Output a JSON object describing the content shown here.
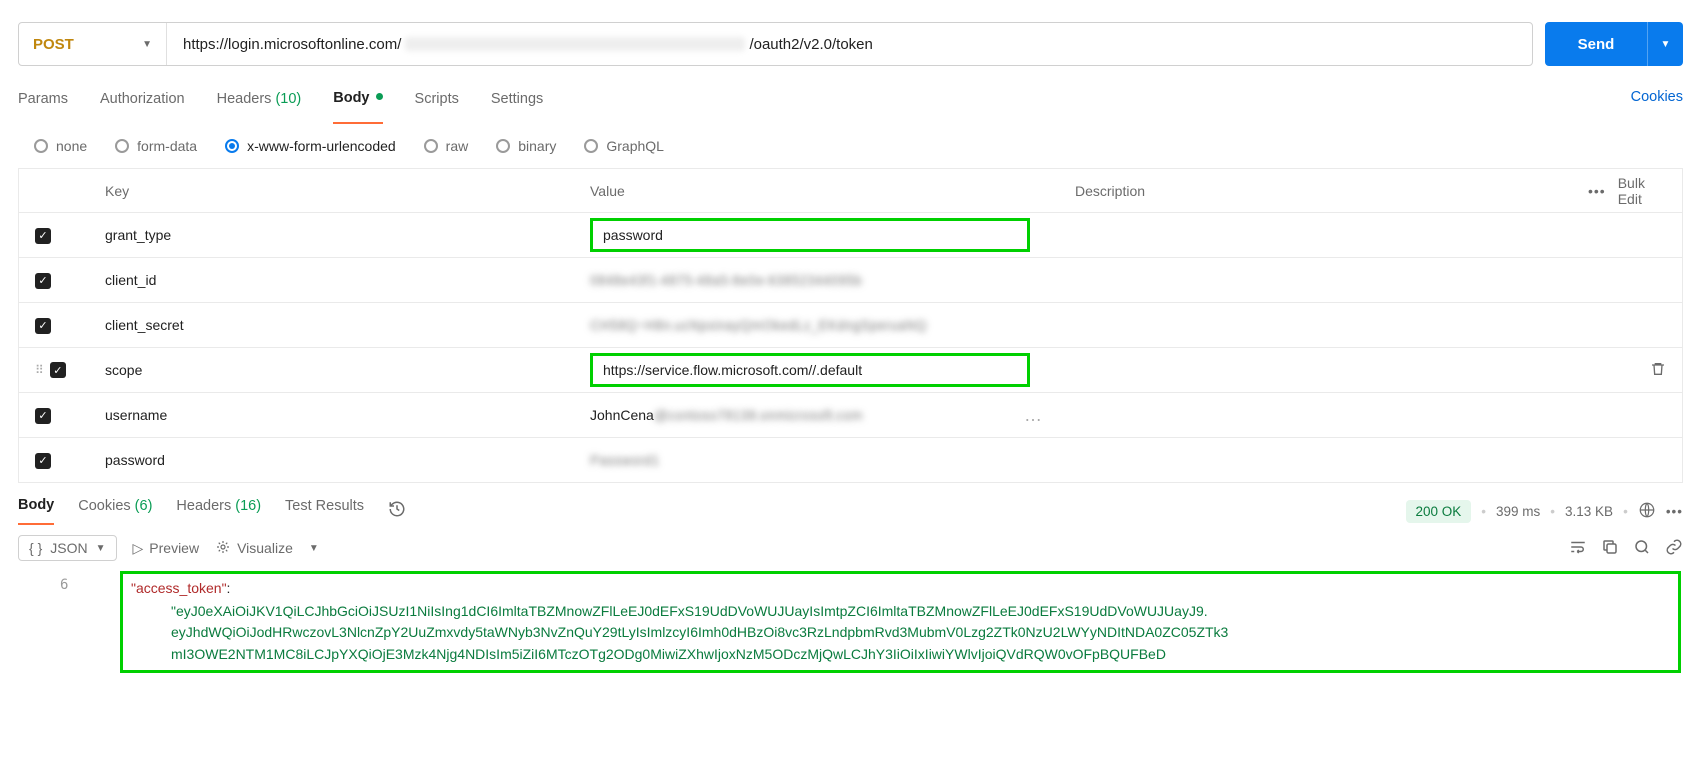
{
  "request": {
    "method": "POST",
    "url_prefix": "https://login.microsoftonline.com/",
    "url_suffix": "/oauth2/v2.0/token",
    "send_label": "Send"
  },
  "tabs": {
    "params": "Params",
    "auth": "Authorization",
    "headers": "Headers",
    "headers_count": "(10)",
    "body": "Body",
    "scripts": "Scripts",
    "settings": "Settings",
    "cookies": "Cookies"
  },
  "body_types": {
    "none": "none",
    "form": "form-data",
    "urlenc": "x-www-form-urlencoded",
    "raw": "raw",
    "binary": "binary",
    "graphql": "GraphQL"
  },
  "kv_header": {
    "key": "Key",
    "value": "Value",
    "desc": "Description",
    "bulk": "Bulk Edit"
  },
  "rows": [
    {
      "key": "grant_type",
      "value": "password",
      "hl": true
    },
    {
      "key": "client_id",
      "value": "0848e43f1-4875-48a5-8e0e-63852344095b",
      "blur": true
    },
    {
      "key": "client_secret",
      "value": "CH58Q~H8n.ucNpxinayQmOkedLz_EKdngSperuaNQ",
      "blur": true
    },
    {
      "key": "scope",
      "value": "https://service.flow.microsoft.com//.default",
      "hl": true
    },
    {
      "key": "username",
      "value": "JohnCena",
      "value_blur_tail": true
    },
    {
      "key": "password",
      "value": "Password1",
      "blur": true
    }
  ],
  "response_tabs": {
    "body": "Body",
    "cookies": "Cookies",
    "cookies_count": "(6)",
    "headers": "Headers",
    "headers_count": "(16)",
    "tests": "Test Results"
  },
  "status": {
    "code": "200 OK",
    "time": "399 ms",
    "size": "3.13 KB"
  },
  "resp_toolbar": {
    "format": "JSON",
    "preview": "Preview",
    "visualize": "Visualize"
  },
  "code": {
    "line_no": "6",
    "key": "\"access_token\"",
    "l1": "\"eyJ0eXAiOiJKV1QiLCJhbGciOiJSUzI1NiIsIng1dCI6ImltaTBZMnowZFlLeEJ0dEFxS19UdDVoWUJUayIsImtpZCI6ImltaTBZMnowZFlLeEJ0dEFxS19UdDVoWUJUayJ9.",
    "l2": "eyJhdWQiOiJodHRwczovL3NlcnZpY2UuZmxvdy5taWNyb3NvZnQuY29tLyIsImlzcyI6Imh0dHBzOi8vc3RzLndpbmRvd3MubmV0Lzg2ZTk0NzU2LWYyNDItNDA0ZC05ZTk3",
    "l3": "mI3OWE2NTM1MC8iLCJpYXQiOjE3Mzk4Njg4NDIsIm5iZiI6MTczOTg2ODg0MiwiZXhwIjoxNzM5ODczMjQwLCJhY3IiOiIxIiwiYWlvIjoiQVdRQW0vOFpBQUFBeD"
  }
}
